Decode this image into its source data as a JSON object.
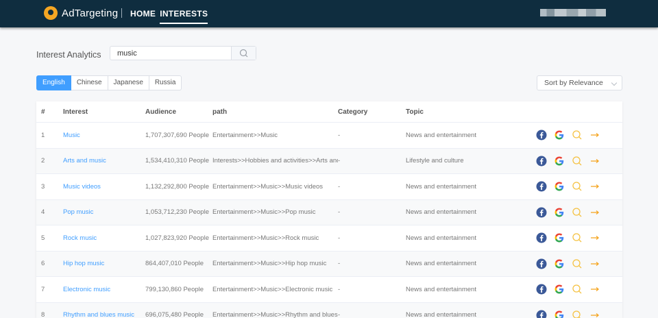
{
  "header": {
    "brand": "AdTargeting",
    "nav": [
      "HOME",
      "INTERESTS"
    ]
  },
  "page": {
    "title": "Interest Analytics",
    "search_value": "music",
    "languages": [
      "English",
      "Chinese",
      "Japanese",
      "Russia"
    ],
    "active_language": "English",
    "sort": "Sort by Relevance"
  },
  "table": {
    "columns": [
      "#",
      "Interest",
      "Audience",
      "path",
      "Category",
      "Topic"
    ],
    "rows": [
      {
        "num": "1",
        "interest": "Music",
        "audience": "1,707,307,690 People",
        "path": "Entertainment>>Music",
        "category": "-",
        "topic": "News and entertainment"
      },
      {
        "num": "2",
        "interest": "Arts and music",
        "audience": "1,534,410,310 People",
        "path": "Interests>>Hobbies and activities>>Arts and m...",
        "category": "-",
        "topic": "Lifestyle and culture"
      },
      {
        "num": "3",
        "interest": "Music videos",
        "audience": "1,132,292,800 People",
        "path": "Entertainment>>Music>>Music videos",
        "category": "-",
        "topic": "News and entertainment"
      },
      {
        "num": "4",
        "interest": "Pop music",
        "audience": "1,053,712,230 People",
        "path": "Entertainment>>Music>>Pop music",
        "category": "-",
        "topic": "News and entertainment"
      },
      {
        "num": "5",
        "interest": "Rock music",
        "audience": "1,027,823,920 People",
        "path": "Entertainment>>Music>>Rock music",
        "category": "-",
        "topic": "News and entertainment"
      },
      {
        "num": "6",
        "interest": "Hip hop music",
        "audience": "864,407,010 People",
        "path": "Entertainment>>Music>>Hip hop music",
        "category": "-",
        "topic": "News and entertainment"
      },
      {
        "num": "7",
        "interest": "Electronic music",
        "audience": "799,130,860 People",
        "path": "Entertainment>>Music>>Electronic music",
        "category": "-",
        "topic": "News and entertainment"
      },
      {
        "num": "8",
        "interest": "Rhythm and blues music",
        "audience": "696,075,480 People",
        "path": "Entertainment>>Music>>Rhythm and blues m...",
        "category": "-",
        "topic": "News and entertainment"
      }
    ],
    "actions": [
      "facebook-icon",
      "google-icon",
      "search-icon",
      "arrow-right-icon"
    ]
  },
  "colors": {
    "topbar": "#0f2d3f",
    "accent": "#409eff",
    "logo": "#f5a623",
    "facebook": "#3b5998",
    "arrow": "#f5a623"
  }
}
